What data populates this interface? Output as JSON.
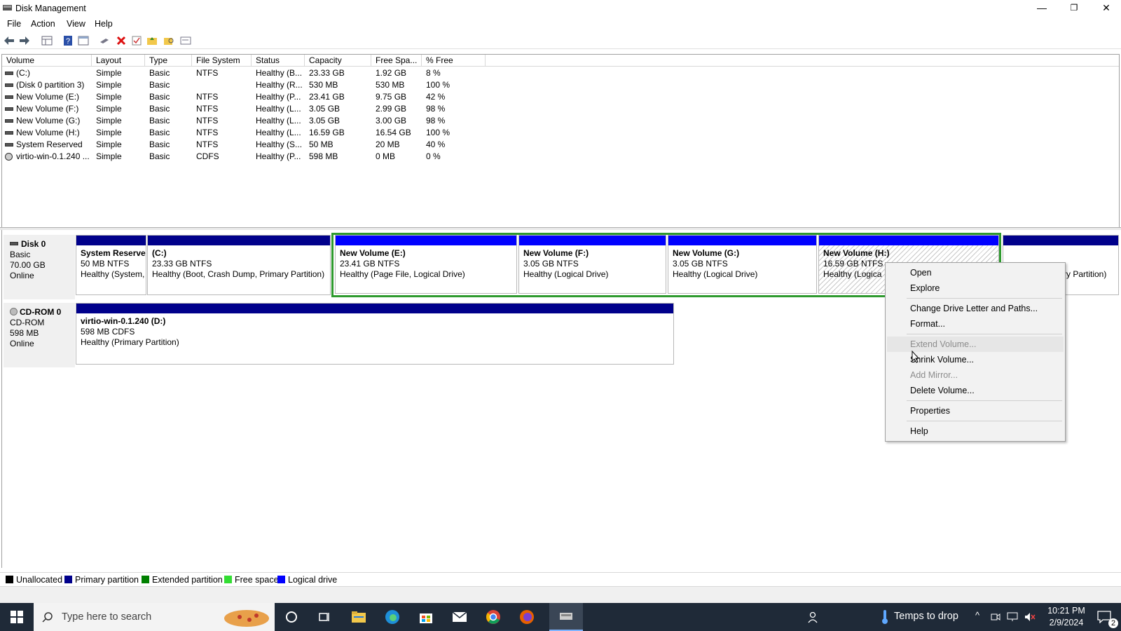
{
  "window": {
    "title": "Disk Management",
    "minimize": "—",
    "restore": "❐",
    "close": "✕"
  },
  "menu": [
    "File",
    "Action",
    "View",
    "Help"
  ],
  "toolbar_icons": [
    "back-icon",
    "forward-icon",
    "properties-grid-icon",
    "help-icon",
    "console-icon",
    "connect-icon",
    "delete-icon",
    "check-icon",
    "folder-up-icon",
    "search-folder-icon",
    "settings-panel-icon"
  ],
  "columns": [
    "Volume",
    "Layout",
    "Type",
    "File System",
    "Status",
    "Capacity",
    "Free Spa...",
    "% Free"
  ],
  "volumes": [
    [
      "(C:)",
      "Simple",
      "Basic",
      "NTFS",
      "Healthy (B...",
      "23.33 GB",
      "1.92 GB",
      "8 %"
    ],
    [
      "(Disk 0 partition 3)",
      "Simple",
      "Basic",
      "",
      "Healthy (R...",
      "530 MB",
      "530 MB",
      "100 %"
    ],
    [
      "New Volume (E:)",
      "Simple",
      "Basic",
      "NTFS",
      "Healthy (P...",
      "23.41 GB",
      "9.75 GB",
      "42 %"
    ],
    [
      "New Volume (F:)",
      "Simple",
      "Basic",
      "NTFS",
      "Healthy (L...",
      "3.05 GB",
      "2.99 GB",
      "98 %"
    ],
    [
      "New Volume (G:)",
      "Simple",
      "Basic",
      "NTFS",
      "Healthy (L...",
      "3.05 GB",
      "3.00 GB",
      "98 %"
    ],
    [
      "New Volume (H:)",
      "Simple",
      "Basic",
      "NTFS",
      "Healthy (L...",
      "16.59 GB",
      "16.54 GB",
      "100 %"
    ],
    [
      "System Reserved",
      "Simple",
      "Basic",
      "NTFS",
      "Healthy (S...",
      "50 MB",
      "20 MB",
      "40 %"
    ],
    [
      "virtio-win-0.1.240 ...",
      "Simple",
      "Basic",
      "CDFS",
      "Healthy (P...",
      "598 MB",
      "0 MB",
      "0 %"
    ]
  ],
  "disk0": {
    "name": "Disk 0",
    "type": "Basic",
    "size": "70.00 GB",
    "status": "Online",
    "partitions": [
      {
        "name": "System Reserve",
        "size": "50 MB NTFS",
        "status": "Healthy (System,"
      },
      {
        "name": "(C:)",
        "size": "23.33 GB NTFS",
        "status": "Healthy (Boot, Crash Dump, Primary Partition)"
      },
      {
        "name": "New Volume  (E:)",
        "size": "23.41 GB NTFS",
        "status": "Healthy (Page File, Logical Drive)"
      },
      {
        "name": "New Volume  (F:)",
        "size": "3.05 GB NTFS",
        "status": "Healthy (Logical Drive)"
      },
      {
        "name": "New Volume  (G:)",
        "size": "3.05 GB NTFS",
        "status": "Healthy (Logical Drive)"
      },
      {
        "name": "New Volume  (H:)",
        "size": "16.59 GB NTFS",
        "status": "Healthy (Logica"
      },
      {
        "name": "",
        "size": "",
        "status": "ry Partition)"
      }
    ]
  },
  "cdrom0": {
    "name": "CD-ROM 0",
    "type": "CD-ROM",
    "size": "598 MB",
    "status": "Online",
    "partition": {
      "name": "virtio-win-0.1.240  (D:)",
      "size": "598 MB CDFS",
      "status": "Healthy (Primary Partition)"
    }
  },
  "legend": [
    {
      "label": "Unallocated",
      "color": "#000000"
    },
    {
      "label": "Primary partition",
      "color": "#00008b"
    },
    {
      "label": "Extended partition",
      "color": "#008000"
    },
    {
      "label": "Free space",
      "color": "#33dd33"
    },
    {
      "label": "Logical drive",
      "color": "#0000ff"
    }
  ],
  "context_menu": {
    "items": [
      {
        "label": "Open",
        "disabled": false
      },
      {
        "label": "Explore",
        "disabled": false
      },
      {
        "label": "Change Drive Letter and Paths...",
        "disabled": false
      },
      {
        "label": "Format...",
        "disabled": false
      },
      {
        "label": "Extend Volume...",
        "disabled": true
      },
      {
        "label": "Shrink Volume...",
        "disabled": false
      },
      {
        "label": "Add Mirror...",
        "disabled": true
      },
      {
        "label": "Delete Volume...",
        "disabled": false
      },
      {
        "label": "Properties",
        "disabled": false
      },
      {
        "label": "Help",
        "disabled": false
      }
    ]
  },
  "taskbar": {
    "search_placeholder": "Type here to search",
    "weather": "Temps to drop",
    "time": "10:21 PM",
    "date": "2/9/2024",
    "notifications": "2"
  },
  "colors": {
    "primary": "#00008b",
    "logical": "#0000ff",
    "extended": "#008000",
    "taskbar": "#1f2a38"
  }
}
